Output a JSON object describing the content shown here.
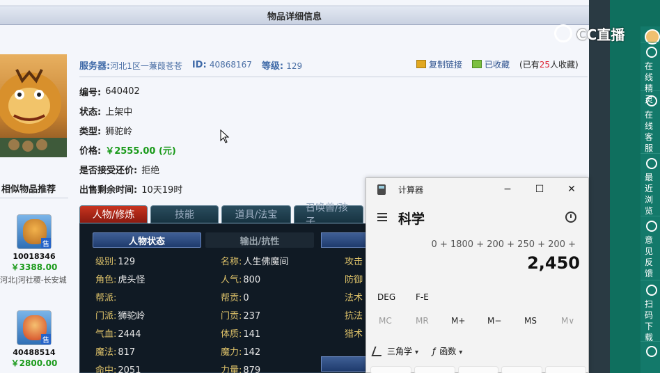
{
  "page": {
    "title": "物品详细信息"
  },
  "overlay": {
    "cc_brand": "CC直播",
    "side_items": [
      {
        "label": "在线精灵",
        "icon": "chat-bubble-icon"
      },
      {
        "label": "在线客服",
        "icon": "headset-icon"
      },
      {
        "label": "最近浏览",
        "icon": "clock-icon"
      },
      {
        "label": "意见反馈",
        "icon": "edit-icon"
      },
      {
        "label": "扫码下载",
        "icon": "scan-icon"
      }
    ]
  },
  "item": {
    "server_label": "服务器:",
    "server_value": "河北1区一蒹葭苍苍",
    "id_label": "ID:",
    "id_value": "40868167",
    "level_label": "等级:",
    "level_value": "129",
    "copy_link": "复制链接",
    "favorited": "已收藏",
    "fav_prefix": "(已有",
    "fav_count": "25",
    "fav_suffix": "人收藏)",
    "number_label": "编号:",
    "number_value": "640402",
    "status_label": "状态:",
    "status_value": "上架中",
    "type_label": "类型:",
    "type_value": "狮驼岭",
    "price_label": "价格:",
    "price_value": "￥2555.00 (元)",
    "bargain_label": "是否接受还价:",
    "bargain_value": "拒绝",
    "remain_label": "出售剩余时间:",
    "remain_value": "10天19时"
  },
  "similar": {
    "header": "相似物品推荐",
    "items": [
      {
        "id": "10018346",
        "price": "￥3388.00",
        "location": "河北|河社稷-长安城",
        "sell": "售"
      },
      {
        "id": "40488514",
        "price": "￥2800.00",
        "sell": "售"
      }
    ]
  },
  "tabs": [
    "人物/修炼",
    "技能",
    "道具/法宝",
    "召唤兽/孩子"
  ],
  "subtabs": [
    "人物状态",
    "输出/抗性"
  ],
  "stats": {
    "col1": [
      {
        "k": "级别:",
        "v": "129"
      },
      {
        "k": "角色:",
        "v": "虎头怪"
      },
      {
        "k": "帮派:",
        "v": ""
      },
      {
        "k": "门派:",
        "v": "狮驼岭"
      },
      {
        "k": "气血:",
        "v": "2444"
      },
      {
        "k": "魔法:",
        "v": "817"
      },
      {
        "k": "命中:",
        "v": "2051"
      }
    ],
    "col2": [
      {
        "k": "名称:",
        "v": "人生佛魔间"
      },
      {
        "k": "人气:",
        "v": "800"
      },
      {
        "k": "帮贡:",
        "v": "0"
      },
      {
        "k": "门贡:",
        "v": "237"
      },
      {
        "k": "体质:",
        "v": "141"
      },
      {
        "k": "魔力:",
        "v": "142"
      },
      {
        "k": "力量:",
        "v": "879"
      }
    ],
    "col3": [
      {
        "k": "攻击",
        "v": ""
      },
      {
        "k": "防御",
        "v": ""
      },
      {
        "k": "法术",
        "v": ""
      },
      {
        "k": "抗法",
        "v": ""
      },
      {
        "k": "猎术",
        "v": ""
      }
    ]
  },
  "calculator": {
    "window_title": "计算器",
    "mode": "科学",
    "expression": "0 + 1800 + 200 + 250 + 200 +",
    "display": "2,450",
    "deg": "DEG",
    "fe": "F-E",
    "memory": [
      "MC",
      "MR",
      "M+",
      "M−",
      "MS",
      "M∨"
    ],
    "trig": "三角学",
    "func": "函数",
    "minimize": "−",
    "maximize": "☐",
    "close": "✕"
  }
}
